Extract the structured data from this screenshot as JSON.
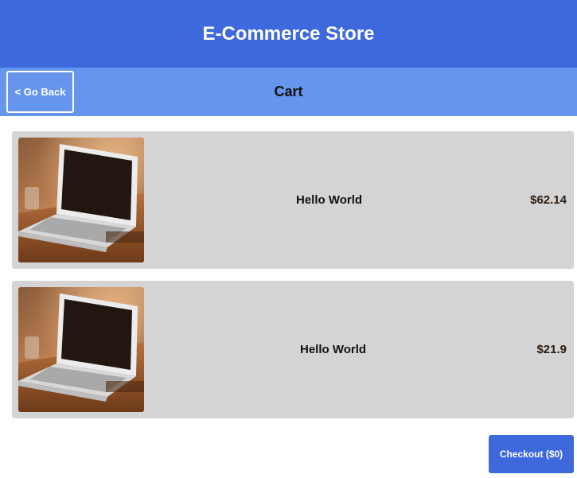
{
  "header": {
    "title": "E-Commerce Store"
  },
  "subbar": {
    "back_label": "< Go Back",
    "title": "Cart"
  },
  "cart": {
    "items": [
      {
        "name": "Hello World",
        "price": "$62.14",
        "image": "laptop-photo"
      },
      {
        "name": "Hello World",
        "price": "$21.9",
        "image": "laptop-photo"
      }
    ]
  },
  "checkout": {
    "label": "Checkout ($0)"
  },
  "colors": {
    "header_bg": "#3e69dd",
    "subbar_bg": "#6595ec",
    "item_bg": "#d4d4d4",
    "checkout_bg": "#3e69dd"
  }
}
